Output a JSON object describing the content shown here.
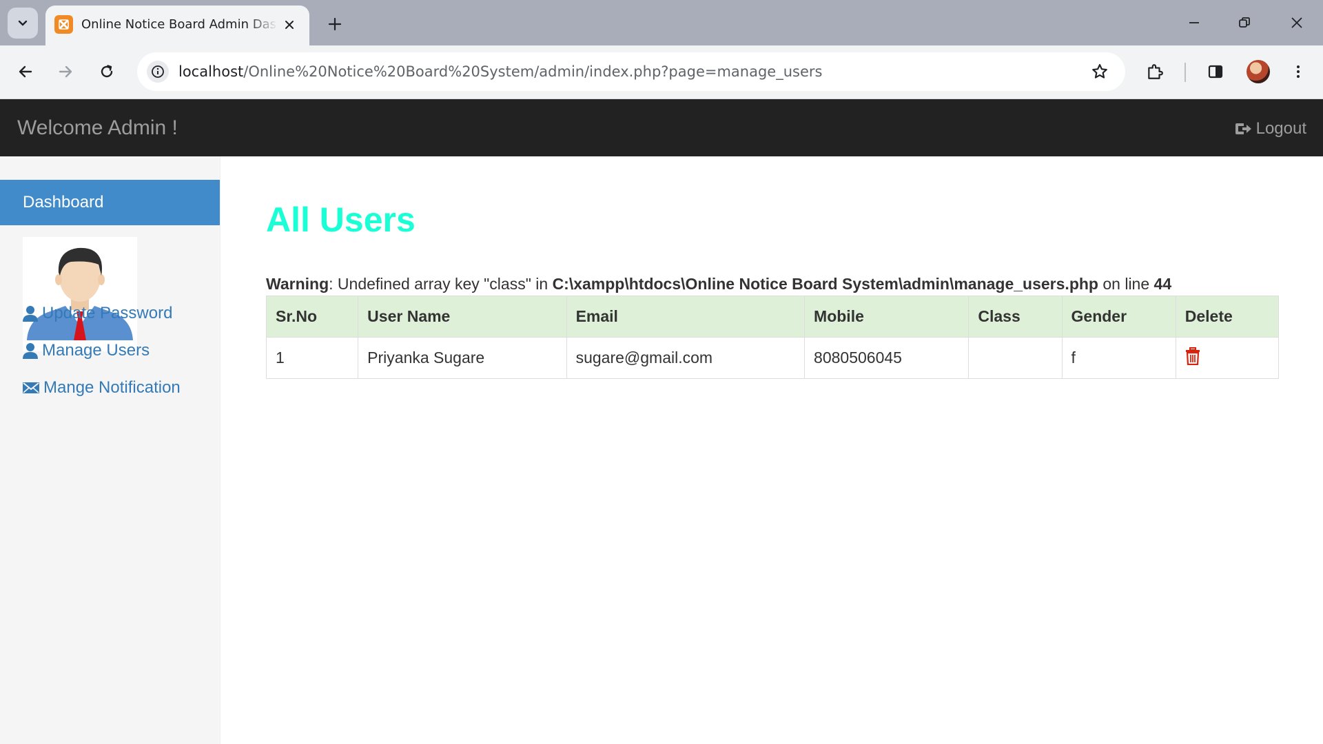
{
  "browser": {
    "tab_title": "Online Notice Board Admin Dashboard",
    "url_host": "localhost",
    "url_path": "/Online%20Notice%20Board%20System/admin/index.php?page=manage_users"
  },
  "navbar": {
    "brand": "Welcome Admin !",
    "logout_label": "Logout",
    "logout_icon": "logout-icon"
  },
  "sidebar": {
    "dashboard_label": "Dashboard",
    "links": [
      {
        "label": "Update Password",
        "icon": "user-icon"
      },
      {
        "label": "Manage Users",
        "icon": "user-icon"
      },
      {
        "label": "Mange Notification",
        "icon": "envelope-icon"
      }
    ]
  },
  "main": {
    "title": "All Users",
    "warning": {
      "prefix": "Warning",
      "message": ": Undefined array key \"class\" in ",
      "file": "C:\\xampp\\htdocs\\Online Notice Board System\\admin\\manage_users.php",
      "on_line": " on line ",
      "line": "44"
    },
    "table": {
      "headers": [
        "Sr.No",
        "User Name",
        "Email",
        "Mobile",
        "Class",
        "Gender",
        "Delete"
      ],
      "rows": [
        {
          "sr": "1",
          "name": "Priyanka Sugare",
          "email": "sugare@gmail.com",
          "mobile": "8080506045",
          "class": "",
          "gender": "f",
          "delete_icon": "trash-icon"
        }
      ]
    }
  },
  "colors": {
    "title": "#1affd5",
    "navbar_bg": "#222222",
    "dashboard_bg": "#428bca",
    "link": "#337ab7",
    "table_header_bg": "#dff0d8",
    "delete": "#d9230f"
  }
}
